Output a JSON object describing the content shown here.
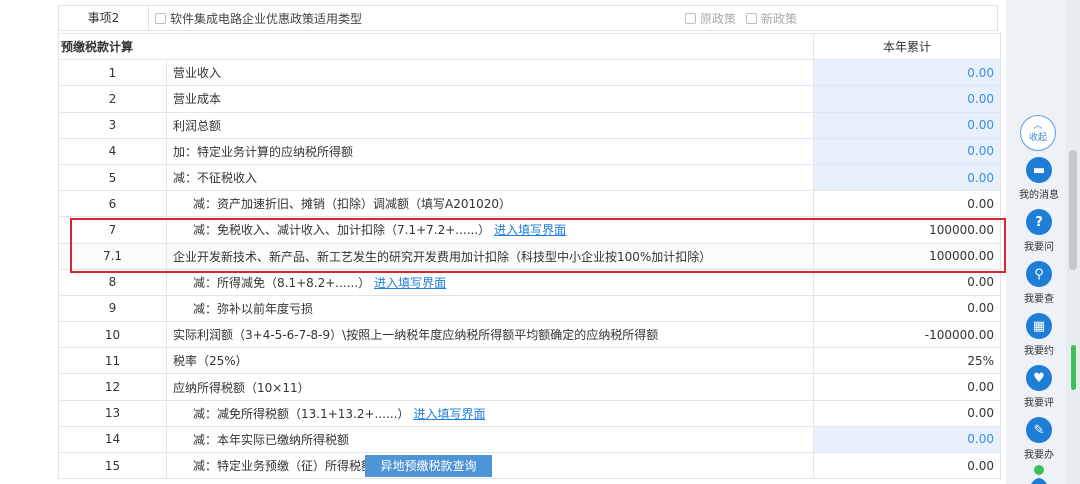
{
  "top_row": {
    "label": "事项2",
    "option": "软件集成电路企业优惠政策适用类型",
    "right_options": [
      "原政策",
      "新政策"
    ]
  },
  "table": {
    "section_title": "预缴税款计算",
    "col_header": "本年累计",
    "rows": [
      {
        "num": "1",
        "desc": "营业收入",
        "link": "",
        "value": "0.00",
        "blue": true
      },
      {
        "num": "2",
        "desc": "营业成本",
        "link": "",
        "value": "0.00",
        "blue": true
      },
      {
        "num": "3",
        "desc": "利润总额",
        "link": "",
        "value": "0.00",
        "blue": true
      },
      {
        "num": "4",
        "desc": "加：特定业务计算的应纳税所得额",
        "link": "",
        "value": "0.00",
        "blue": true
      },
      {
        "num": "5",
        "desc": "减：不征税收入",
        "link": "",
        "value": "0.00",
        "blue": true
      },
      {
        "num": "6",
        "desc": "减：资产加速折旧、摊销（扣除）调减额（填写A201020）",
        "link": "",
        "value": "0.00",
        "blue": false
      },
      {
        "num": "7",
        "desc": "减：免税收入、减计收入、加计扣除（7.1+7.2+......）",
        "link": "进入填写界面",
        "value": "100000.00",
        "blue": false
      },
      {
        "num": "7.1",
        "desc": "企业开发新技术、新产品、新工艺发生的研究开发费用加计扣除（科技型中小企业按100%加计扣除）",
        "link": "",
        "value": "100000.00",
        "blue": false
      },
      {
        "num": "8",
        "desc": "减：所得减免（8.1+8.2+......）",
        "link": "进入填写界面",
        "value": "0.00",
        "blue": false
      },
      {
        "num": "9",
        "desc": "减：弥补以前年度亏损",
        "link": "",
        "value": "0.00",
        "blue": false
      },
      {
        "num": "10",
        "desc": "实际利润额（3+4-5-6-7-8-9）\\按照上一纳税年度应纳税所得额平均额确定的应纳税所得额",
        "link": "",
        "value": "-100000.00",
        "blue": false
      },
      {
        "num": "11",
        "desc": "税率（25%）",
        "link": "",
        "value": "25%",
        "blue": false
      },
      {
        "num": "12",
        "desc": "应纳所得税额（10×11）",
        "link": "",
        "value": "0.00",
        "blue": false
      },
      {
        "num": "13",
        "desc": "减：减免所得税额（13.1+13.2+......）",
        "link": "进入填写界面",
        "value": "0.00",
        "blue": false
      },
      {
        "num": "14",
        "desc": "减：本年实际已缴纳所得税额",
        "link": "",
        "value": "0.00",
        "blue": true
      },
      {
        "num": "15",
        "desc": "减：特定业务预缴（征）所得税额",
        "link": "",
        "value": "0.00",
        "blue": false
      }
    ]
  },
  "float_button": "异地预缴税款查询",
  "sidebar": {
    "collapse_label": "收起",
    "items": [
      {
        "label": "我的消息",
        "icon": "message-icon"
      },
      {
        "label": "我要问",
        "icon": "question-icon"
      },
      {
        "label": "我要查",
        "icon": "search-icon"
      },
      {
        "label": "我要约",
        "icon": "calendar-icon"
      },
      {
        "label": "我要评",
        "icon": "rate-icon"
      },
      {
        "label": "我要办",
        "icon": "edit-icon"
      }
    ]
  },
  "colors": {
    "accent": "#1e7ed6",
    "highlight_border": "#d6262e",
    "blue_cell": "#e8f1fb"
  }
}
